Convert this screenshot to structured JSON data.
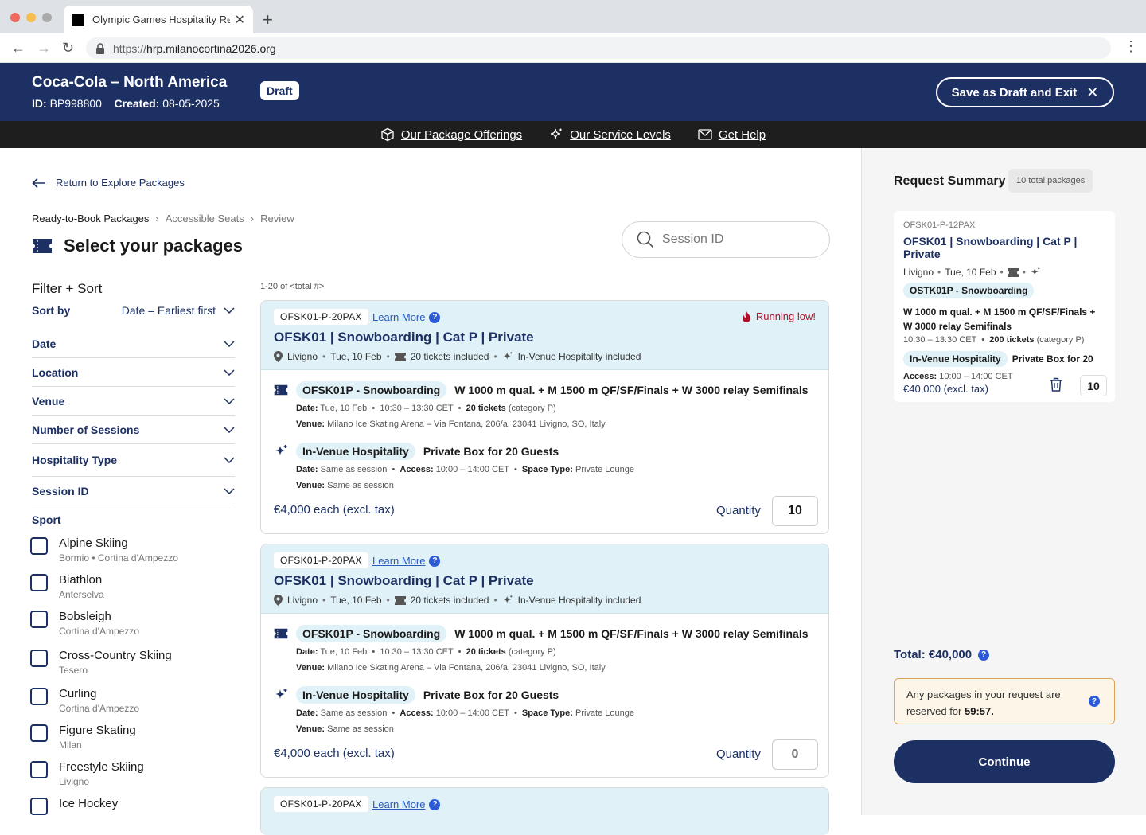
{
  "browser": {
    "tab_title": "Olympic Games Hospitality Rec",
    "url_prefix": "https://",
    "url_host": "hrp.milanocortina2026.org"
  },
  "header": {
    "name": "Coca-Cola – North America",
    "id_label": "ID:",
    "id_value": "BP998800",
    "created_label": "Created:",
    "created_value": "08-05-2025",
    "status": "Draft",
    "save_label": "Save as Draft and Exit"
  },
  "subnav": {
    "items": [
      {
        "label": "Our Package Offerings",
        "icon": "box-icon"
      },
      {
        "label": "Our Service Levels",
        "icon": "sparkle-icon"
      },
      {
        "label": "Get Help",
        "icon": "mail-icon"
      }
    ]
  },
  "main": {
    "back_label": "Return to Explore Packages",
    "breadcrumb": [
      "Ready-to-Book Packages",
      "Accessible Seats",
      "Review"
    ],
    "title": "Select your packages",
    "search_placeholder": "Session ID",
    "result_count": "1-20 of <total #>"
  },
  "filter": {
    "heading": "Filter + Sort",
    "sort_label": "Sort by",
    "sort_value": "Date – Earliest first",
    "rows": [
      "Date",
      "Location",
      "Venue",
      "Number of Sessions",
      "Hospitality Type",
      "Session ID"
    ],
    "sport_heading": "Sport",
    "sports": [
      {
        "name": "Alpine Skiing",
        "sub": "Bormio  •  Cortina d'Ampezzo"
      },
      {
        "name": "Biathlon",
        "sub": "Anterselva"
      },
      {
        "name": "Bobsleigh",
        "sub": "Cortina d'Ampezzo"
      },
      {
        "name": "Cross-Country Skiing",
        "sub": "Tesero"
      },
      {
        "name": "Curling",
        "sub": "Cortina d'Ampezzo"
      },
      {
        "name": "Figure Skating",
        "sub": "Milan"
      },
      {
        "name": "Freestyle Skiing",
        "sub": "Livigno"
      },
      {
        "name": "Ice Hockey",
        "sub": ""
      }
    ]
  },
  "cards": [
    {
      "code": "OFSK01-P-20PAX",
      "learn_more": "Learn More",
      "running_low": "Running low!",
      "title": "OFSK01 | Snowboarding | Cat P | Private",
      "location": "Livigno",
      "date": "Tue, 10 Feb",
      "tickets": "20 tickets included",
      "hospitality_included": "In-Venue Hospitality included",
      "session_pill": "OFSK01P - Snowboarding",
      "session_desc": "W 1000 m qual. + M 1500 m QF/SF/Finals + W 3000 relay Semifinals",
      "session_date_label": "Date:",
      "session_date": "Tue, 10 Feb",
      "session_time": "10:30 – 13:30 CET",
      "session_tickets": "20 tickets",
      "session_category": "(category P)",
      "venue_label": "Venue:",
      "venue": "Milano Ice Skating Arena – Via Fontana, 206/a, 23041 Livigno, SO, Italy",
      "hosp_pill": "In-Venue Hospitality",
      "hosp_desc": "Private Box for 20 Guests",
      "hosp_date_label": "Date:",
      "hosp_date": "Same as session",
      "access_label": "Access:",
      "access": "10:00 – 14:00 CET",
      "space_label": "Space Type:",
      "space": "Private Lounge",
      "hosp_venue_label": "Venue:",
      "hosp_venue": "Same as session",
      "price": "€4,000 each (excl. tax)",
      "quantity_label": "Quantity",
      "quantity": "10"
    },
    {
      "code": "OFSK01-P-20PAX",
      "learn_more": "Learn More",
      "running_low": "",
      "title": "OFSK01 | Snowboarding | Cat P | Private",
      "location": "Livigno",
      "date": "Tue, 10 Feb",
      "tickets": "20 tickets included",
      "hospitality_included": "In-Venue Hospitality included",
      "session_pill": "OFSK01P - Snowboarding",
      "session_desc": "W 1000 m qual. + M 1500 m QF/SF/Finals + W 3000 relay Semifinals",
      "session_date_label": "Date:",
      "session_date": "Tue, 10 Feb",
      "session_time": "10:30 – 13:30 CET",
      "session_tickets": "20 tickets",
      "session_category": "(category P)",
      "venue_label": "Venue:",
      "venue": "Milano Ice Skating Arena – Via Fontana, 206/a, 23041 Livigno, SO, Italy",
      "hosp_pill": "In-Venue Hospitality",
      "hosp_desc": "Private Box for 20 Guests",
      "hosp_date_label": "Date:",
      "hosp_date": "Same as session",
      "access_label": "Access:",
      "access": "10:00 – 14:00 CET",
      "space_label": "Space Type:",
      "space": "Private Lounge",
      "hosp_venue_label": "Venue:",
      "hosp_venue": "Same as session",
      "price": "€4,000 each (excl. tax)",
      "quantity_label": "Quantity",
      "quantity": "0"
    },
    {
      "code": "OFSK01-P-20PAX",
      "learn_more": "Learn More"
    }
  ],
  "summary": {
    "heading": "Request Summary",
    "badge": "10 total packages",
    "item": {
      "code": "OFSK01-P-12PAX",
      "title": "OFSK01 | Snowboarding | Cat P | Private",
      "location": "Livigno",
      "date": "Tue, 10 Feb",
      "session_pill": "OSTK01P - Snowboarding",
      "session_desc": "W 1000 m qual. + M 1500 m QF/SF/Finals + W 3000 relay Semifinals",
      "time": "10:30 – 13:30 CET",
      "tickets": "200 tickets",
      "category": "(category P)",
      "hosp_pill": "In-Venue Hospitality",
      "hosp_desc": "Private Box for 20",
      "access_label": "Access:",
      "access": "10:00 – 14:00 CET",
      "price": "€40,000 (excl. tax)",
      "quantity": "10"
    },
    "total": "Total: €40,000",
    "notice_text": "Any packages in your request are reserved for",
    "notice_time": "59:57.",
    "continue": "Continue"
  },
  "colors": {
    "navy": "#1c3064",
    "light_blue": "#e0f1f7",
    "alert_red": "#b0122b"
  }
}
